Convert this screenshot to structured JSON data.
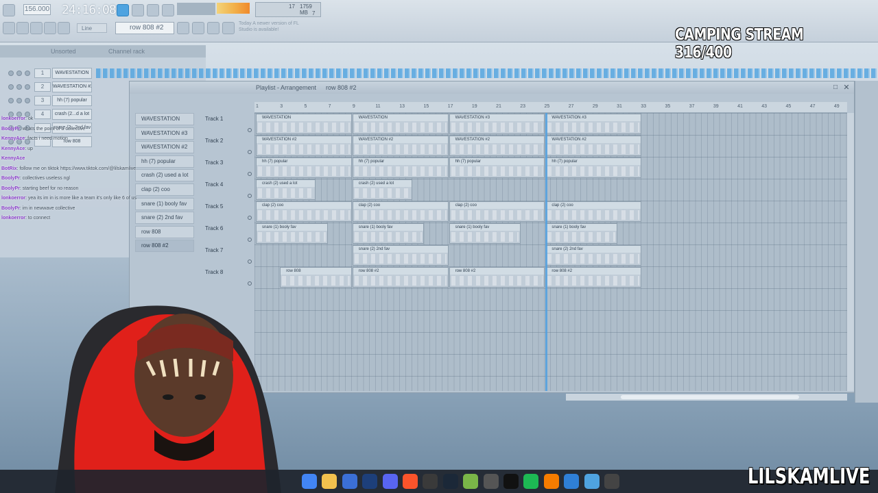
{
  "toolbar": {
    "bpm": "156.000",
    "time": "24:16:08",
    "cpu_top": "17",
    "cpu_mem": "1759 MB",
    "cpu_bottom": "7",
    "line_mode": "Line",
    "pattern": "row 808 #2",
    "update_notice": "Today  A newer version of FL Studio is available!"
  },
  "stream_title": "CAMPING STREAM 316/400",
  "streamer_name": "LILSKAMLIVE",
  "channel_rack": {
    "title": "Channel rack",
    "filter": "Unsorted",
    "rows": [
      {
        "num": "1",
        "name": "WAVESTATION"
      },
      {
        "num": "2",
        "name": "WAVESTATION #2"
      },
      {
        "num": "3",
        "name": "hh (7) popular"
      },
      {
        "num": "4",
        "name": "crash (2...d a lot"
      },
      {
        "num": "",
        "name": "snare (2...2nd fav"
      },
      {
        "num": "",
        "name": "row 808"
      }
    ]
  },
  "playlist": {
    "title": "Playlist - Arrangement",
    "pattern": "row 808 #2",
    "patterns": [
      "WAVESTATION",
      "WAVESTATION #3",
      "WAVESTATION #2",
      "hh (7) popular",
      "crash (2) used a lot",
      "clap (2) coo",
      "snare (1) booly fav",
      "snare (2) 2nd fav",
      "row 808",
      "row 808 #2"
    ],
    "ruler": [
      "1",
      "3",
      "5",
      "7",
      "9",
      "11",
      "13",
      "15",
      "17",
      "19",
      "21",
      "23",
      "25",
      "27",
      "29",
      "31",
      "33",
      "35",
      "37",
      "39",
      "41",
      "43",
      "45",
      "47",
      "49"
    ],
    "tracks": [
      "Track 1",
      "Track 2",
      "Track 3",
      "Track 4",
      "Track 5",
      "Track 6",
      "Track 7",
      "Track 8"
    ],
    "clips": [
      {
        "track": 0,
        "start": 1,
        "len": 8,
        "label": "WAVESTATION"
      },
      {
        "track": 0,
        "start": 9,
        "len": 8,
        "label": "WAVESTATION"
      },
      {
        "track": 0,
        "start": 17,
        "len": 8,
        "label": "WAVESTATION #3"
      },
      {
        "track": 0,
        "start": 25,
        "len": 8,
        "label": "WAVESTATION #3"
      },
      {
        "track": 1,
        "start": 1,
        "len": 8,
        "label": "WAVESTATION #2"
      },
      {
        "track": 1,
        "start": 9,
        "len": 8,
        "label": "WAVESTATION #2"
      },
      {
        "track": 1,
        "start": 17,
        "len": 8,
        "label": "WAVESTATION #2"
      },
      {
        "track": 1,
        "start": 25,
        "len": 8,
        "label": "WAVESTATION #2"
      },
      {
        "track": 2,
        "start": 1,
        "len": 8,
        "label": "hh (7) popular"
      },
      {
        "track": 2,
        "start": 9,
        "len": 8,
        "label": "hh (7) popular"
      },
      {
        "track": 2,
        "start": 17,
        "len": 8,
        "label": "hh (7) popular"
      },
      {
        "track": 2,
        "start": 25,
        "len": 8,
        "label": "hh (7) popular"
      },
      {
        "track": 3,
        "start": 1,
        "len": 5,
        "label": "crash (2) used a lot"
      },
      {
        "track": 3,
        "start": 9,
        "len": 5,
        "label": "crash (2) used a lot"
      },
      {
        "track": 4,
        "start": 1,
        "len": 8,
        "label": "clap (2) coo"
      },
      {
        "track": 4,
        "start": 9,
        "len": 8,
        "label": "clap (2) coo"
      },
      {
        "track": 4,
        "start": 17,
        "len": 8,
        "label": "clap (2) coo"
      },
      {
        "track": 4,
        "start": 25,
        "len": 8,
        "label": "clap (2) coo"
      },
      {
        "track": 5,
        "start": 1,
        "len": 6,
        "label": "snare (1) booly fav"
      },
      {
        "track": 5,
        "start": 9,
        "len": 6,
        "label": "snare (1) booly fav"
      },
      {
        "track": 5,
        "start": 17,
        "len": 6,
        "label": "snare (1) booly fav"
      },
      {
        "track": 5,
        "start": 25,
        "len": 6,
        "label": "snare (1) booly fav"
      },
      {
        "track": 6,
        "start": 9,
        "len": 8,
        "label": "snare (2) 2nd fav"
      },
      {
        "track": 6,
        "start": 25,
        "len": 8,
        "label": "snare (2) 2nd fav"
      },
      {
        "track": 7,
        "start": 3,
        "len": 6,
        "label": "row 808"
      },
      {
        "track": 7,
        "start": 9,
        "len": 8,
        "label": "row 808 #2"
      },
      {
        "track": 7,
        "start": 17,
        "len": 8,
        "label": "row 808 #2"
      },
      {
        "track": 7,
        "start": 25,
        "len": 8,
        "label": "row 808 #2"
      }
    ],
    "playhead_bar": 25
  },
  "chat": [
    {
      "user": "lonkoerror",
      "msg": ": ok"
    },
    {
      "user": "BoolyPr",
      "msg": ": whats the point of a collective"
    },
    {
      "user": "KennyAce",
      "msg": ": facts i need motion"
    },
    {
      "user": "KennyAce",
      "msg": ": up"
    },
    {
      "user": "KennyAce",
      "msg": ""
    },
    {
      "user": "BotRix",
      "msg": ": follow me on tiktok https://www.tiktok.com/@lilskamlive"
    },
    {
      "user": "BoolyPr",
      "msg": ": collectives useless ngl"
    },
    {
      "user": "BoolyPr",
      "msg": ": starting beef for no reason"
    },
    {
      "user": "lonkoerror",
      "msg": ": yea its im in is more like a team it's only like 6 of us"
    },
    {
      "user": "BoolyPr",
      "msg": ": im in newwave collective"
    },
    {
      "user": "lonkoerror",
      "msg": ": to connect"
    }
  ],
  "taskbar_icons": [
    "chrome-icon",
    "folder-icon",
    "store-icon",
    "photoshop-icon",
    "discord-icon",
    "brave-icon",
    "obs-icon",
    "steam-icon",
    "game-icon",
    "app-icon",
    "capcut-icon",
    "spotify-icon",
    "fl-studio-icon",
    "bluetooth-icon",
    "notepad-icon",
    "play-icon"
  ]
}
